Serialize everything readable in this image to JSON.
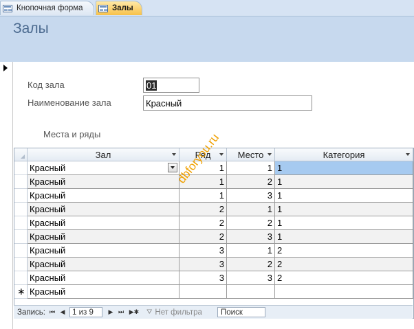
{
  "tabs": [
    {
      "label": "Кнопочная форма",
      "active": false
    },
    {
      "label": "Залы",
      "active": true
    }
  ],
  "form": {
    "title": "Залы",
    "code_label": "Код зала",
    "code_value": "01",
    "name_label": "Наименование зала",
    "name_value": "Красный",
    "subform_label": "Места и ряды"
  },
  "grid": {
    "columns": [
      "Зал",
      "Ряд",
      "Место",
      "Категория"
    ],
    "rows": [
      {
        "hall": "Красный",
        "row": "1",
        "seat": "1",
        "category": "1"
      },
      {
        "hall": "Красный",
        "row": "1",
        "seat": "2",
        "category": "1"
      },
      {
        "hall": "Красный",
        "row": "1",
        "seat": "3",
        "category": "1"
      },
      {
        "hall": "Красный",
        "row": "2",
        "seat": "1",
        "category": "1"
      },
      {
        "hall": "Красный",
        "row": "2",
        "seat": "2",
        "category": "1"
      },
      {
        "hall": "Красный",
        "row": "2",
        "seat": "3",
        "category": "1"
      },
      {
        "hall": "Красный",
        "row": "3",
        "seat": "1",
        "category": "2"
      },
      {
        "hall": "Красный",
        "row": "3",
        "seat": "2",
        "category": "2"
      },
      {
        "hall": "Красный",
        "row": "3",
        "seat": "3",
        "category": "2"
      }
    ],
    "new_row_hall": "Красный",
    "new_row_marker": "∗"
  },
  "navigation": {
    "record_label": "Запись:",
    "first": "⏮",
    "prev": "◀",
    "position": "1 из 9",
    "next": "▶",
    "last": "⏭",
    "new": "▶✱",
    "filter": "Нет фильтра",
    "search": "Поиск"
  },
  "watermark": "dbforyou.ru",
  "colors": {
    "header_band": "#c7d9ee",
    "selection": "#a6caf0",
    "watermark": "#f0a000"
  }
}
